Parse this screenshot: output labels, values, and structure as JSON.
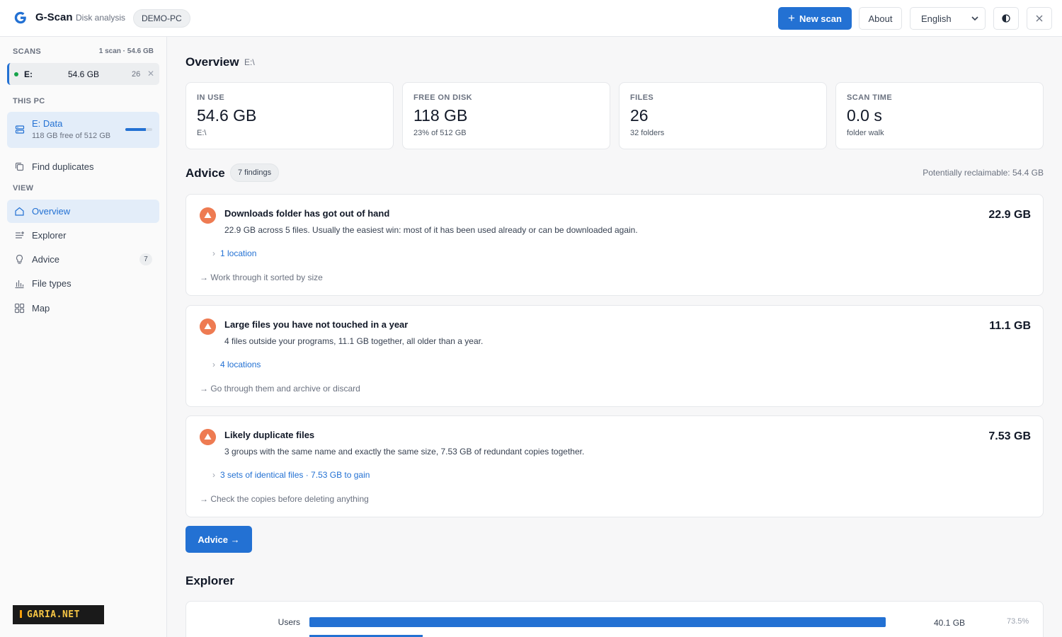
{
  "header": {
    "app_name": "G-Scan",
    "app_subtitle": "Disk analysis",
    "machine": "DEMO-PC",
    "new_scan_label": "New scan",
    "about_label": "About",
    "language": "English",
    "accent_color": "#2371d3"
  },
  "sidebar": {
    "scans_heading": "SCANS",
    "scans_meta": "1 scan · 54.6 GB",
    "scans": [
      {
        "drive": "E:",
        "size": "54.6 GB",
        "count": "26"
      }
    ],
    "this_pc_heading": "THIS PC",
    "drives": [
      {
        "name": "E: Data",
        "free": "118 GB free of 512 GB",
        "used_fraction": 0.77
      }
    ],
    "find_duplicates": "Find duplicates",
    "view_heading": "VIEW",
    "nav": [
      {
        "label": "Overview",
        "icon": "home-icon"
      },
      {
        "label": "Explorer",
        "icon": "list-icon"
      },
      {
        "label": "Advice",
        "icon": "bulb-icon",
        "badge": "7"
      },
      {
        "label": "File types",
        "icon": "bar-chart-icon"
      },
      {
        "label": "Map",
        "icon": "grid-icon"
      }
    ],
    "watermark": "GARIA.NET"
  },
  "main": {
    "overview_title": "Overview",
    "overview_path": "E:\\",
    "stats": [
      {
        "label": "IN USE",
        "value": "54.6 GB",
        "note": "E:\\"
      },
      {
        "label": "FREE ON DISK",
        "value": "118 GB",
        "note": "23% of 512 GB"
      },
      {
        "label": "FILES",
        "value": "26",
        "note": "32 folders"
      },
      {
        "label": "SCAN TIME",
        "value": "0.0 s",
        "note": "folder walk"
      }
    ],
    "advice_title": "Advice",
    "advice_count": "7 findings",
    "reclaimable": "Potentially reclaimable: 54.4 GB",
    "findings": [
      {
        "title": "Downloads folder has got out of hand",
        "desc": "22.9 GB across 5 files. Usually the easiest win: most of it has been used already or can be downloaded again.",
        "link": "1 location",
        "action": "→ Work through it sorted by size",
        "size": "22.9 GB"
      },
      {
        "title": "Large files you have not touched in a year",
        "desc": "4 files outside your programs, 11.1 GB together, all older than a year.",
        "link": "4 locations",
        "action": "→ Go through them and archive or discard",
        "size": "11.1 GB"
      },
      {
        "title": "Likely duplicate files",
        "desc": "3 groups with the same name and exactly the same size, 7.53 GB of redundant copies together.",
        "link": "3 sets of identical files · 7.53 GB to gain",
        "action": "→ Check the copies before deleting anything",
        "size": "7.53 GB"
      }
    ],
    "advice_button": "Advice →",
    "explorer_title": "Explorer",
    "explorer_rows": [
      {
        "name": "Users",
        "size": "40.1 GB",
        "pct": "73.5%",
        "fraction": 0.735
      }
    ]
  }
}
